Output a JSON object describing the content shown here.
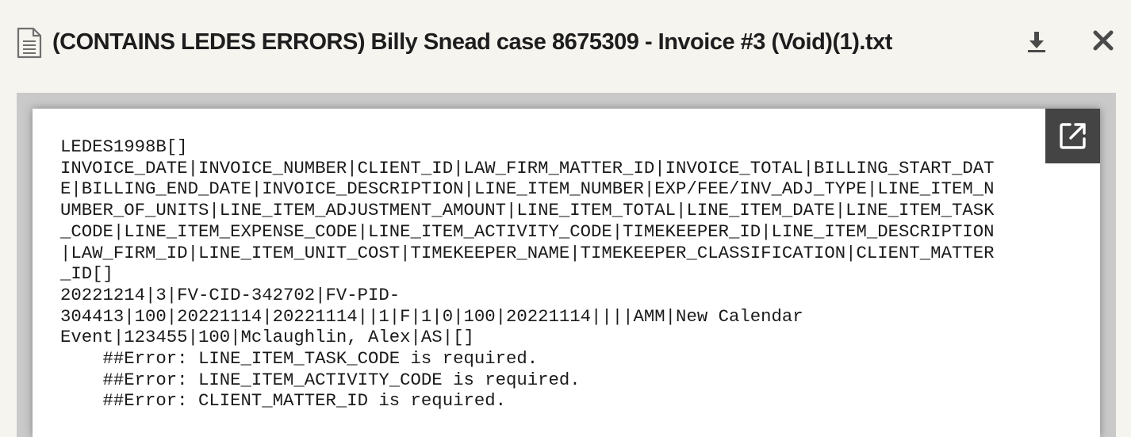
{
  "header": {
    "title": "(CONTAINS LEDES ERRORS) Billy Snead case 8675309 - Invoice #3 (Void)(1).txt",
    "file_icon": "document-icon",
    "download_icon": "download-icon",
    "close_icon": "close-icon"
  },
  "viewer": {
    "popout_icon": "open-external-icon",
    "content": "LEDES1998B[]\nINVOICE_DATE|INVOICE_NUMBER|CLIENT_ID|LAW_FIRM_MATTER_ID|INVOICE_TOTAL|BILLING_START_DAT\nE|BILLING_END_DATE|INVOICE_DESCRIPTION|LINE_ITEM_NUMBER|EXP/FEE/INV_ADJ_TYPE|LINE_ITEM_N\nUMBER_OF_UNITS|LINE_ITEM_ADJUSTMENT_AMOUNT|LINE_ITEM_TOTAL|LINE_ITEM_DATE|LINE_ITEM_TASK\n_CODE|LINE_ITEM_EXPENSE_CODE|LINE_ITEM_ACTIVITY_CODE|TIMEKEEPER_ID|LINE_ITEM_DESCRIPTION\n|LAW_FIRM_ID|LINE_ITEM_UNIT_COST|TIMEKEEPER_NAME|TIMEKEEPER_CLASSIFICATION|CLIENT_MATTER\n_ID[]\n20221214|3|FV-CID-342702|FV-PID-\n304413|100|20221114|20221114||1|F|1|0|100|20221114||||AMM|New Calendar\nEvent|123455|100|Mclaughlin, Alex|AS|[]\n    ##Error: LINE_ITEM_TASK_CODE is required.\n    ##Error: LINE_ITEM_ACTIVITY_CODE is required.\n    ##Error: CLIENT_MATTER_ID is required."
  },
  "colors": {
    "background": "#f6f4ef",
    "frame": "#c9c9c9",
    "popout_button": "#444444",
    "text": "#1d1d1d"
  }
}
